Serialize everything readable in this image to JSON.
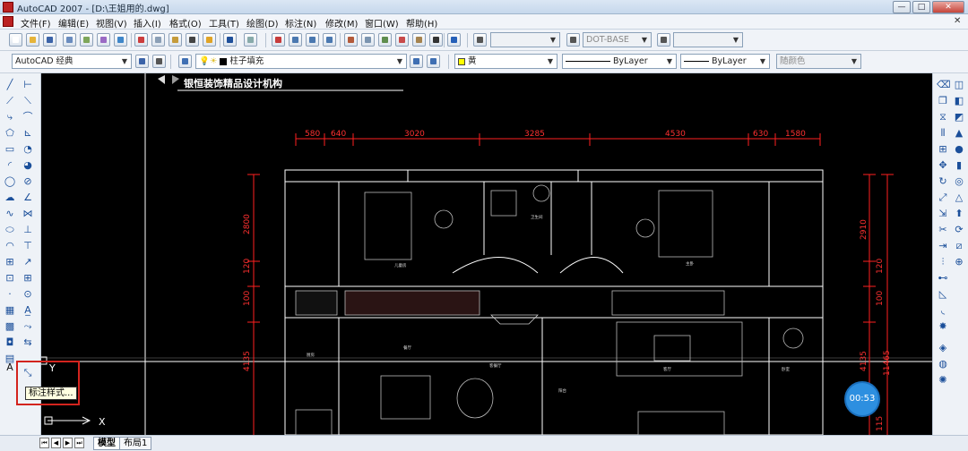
{
  "window": {
    "title": "AutoCAD 2007 - [D:\\王姐用的.dwg]",
    "minimize": "—",
    "restore": "□",
    "close": "✕"
  },
  "menu": [
    "文件(F)",
    "编辑(E)",
    "视图(V)",
    "插入(I)",
    "格式(O)",
    "工具(T)",
    "绘图(D)",
    "标注(N)",
    "修改(M)",
    "窗口(W)",
    "帮助(H)"
  ],
  "toolbar": {
    "workspace": "AutoCAD 经典",
    "layer": "柱子填充",
    "color": "黄",
    "linetype": "ByLayer",
    "lineweight": "ByLayer",
    "plotstyle": "随颜色",
    "dimstyle": "DOT-BASE"
  },
  "drawing": {
    "company": "银恒装饰精品设计机构",
    "dims_top": [
      "580",
      "640",
      "3020",
      "3285",
      "4530",
      "630",
      "1580"
    ],
    "dims_left": [
      "2800",
      "120",
      "100",
      "4135"
    ],
    "dims_right": [
      "2910",
      "120",
      "100",
      "4135",
      "11465",
      "115"
    ],
    "rooms": [
      "儿童房",
      "卫生间",
      "主卧",
      "餐厅",
      "客厅",
      "阳台",
      "卧室",
      "厨房",
      "客餐厅"
    ],
    "ucs_x": "X",
    "ucs_y": "Y"
  },
  "tooltip": "标注样式...",
  "timer": "00:53",
  "tabs": [
    "模型",
    "布局1"
  ],
  "colors": {
    "canvas": "#000000",
    "dim": "#ff2020",
    "highlight": "#d3241e"
  }
}
